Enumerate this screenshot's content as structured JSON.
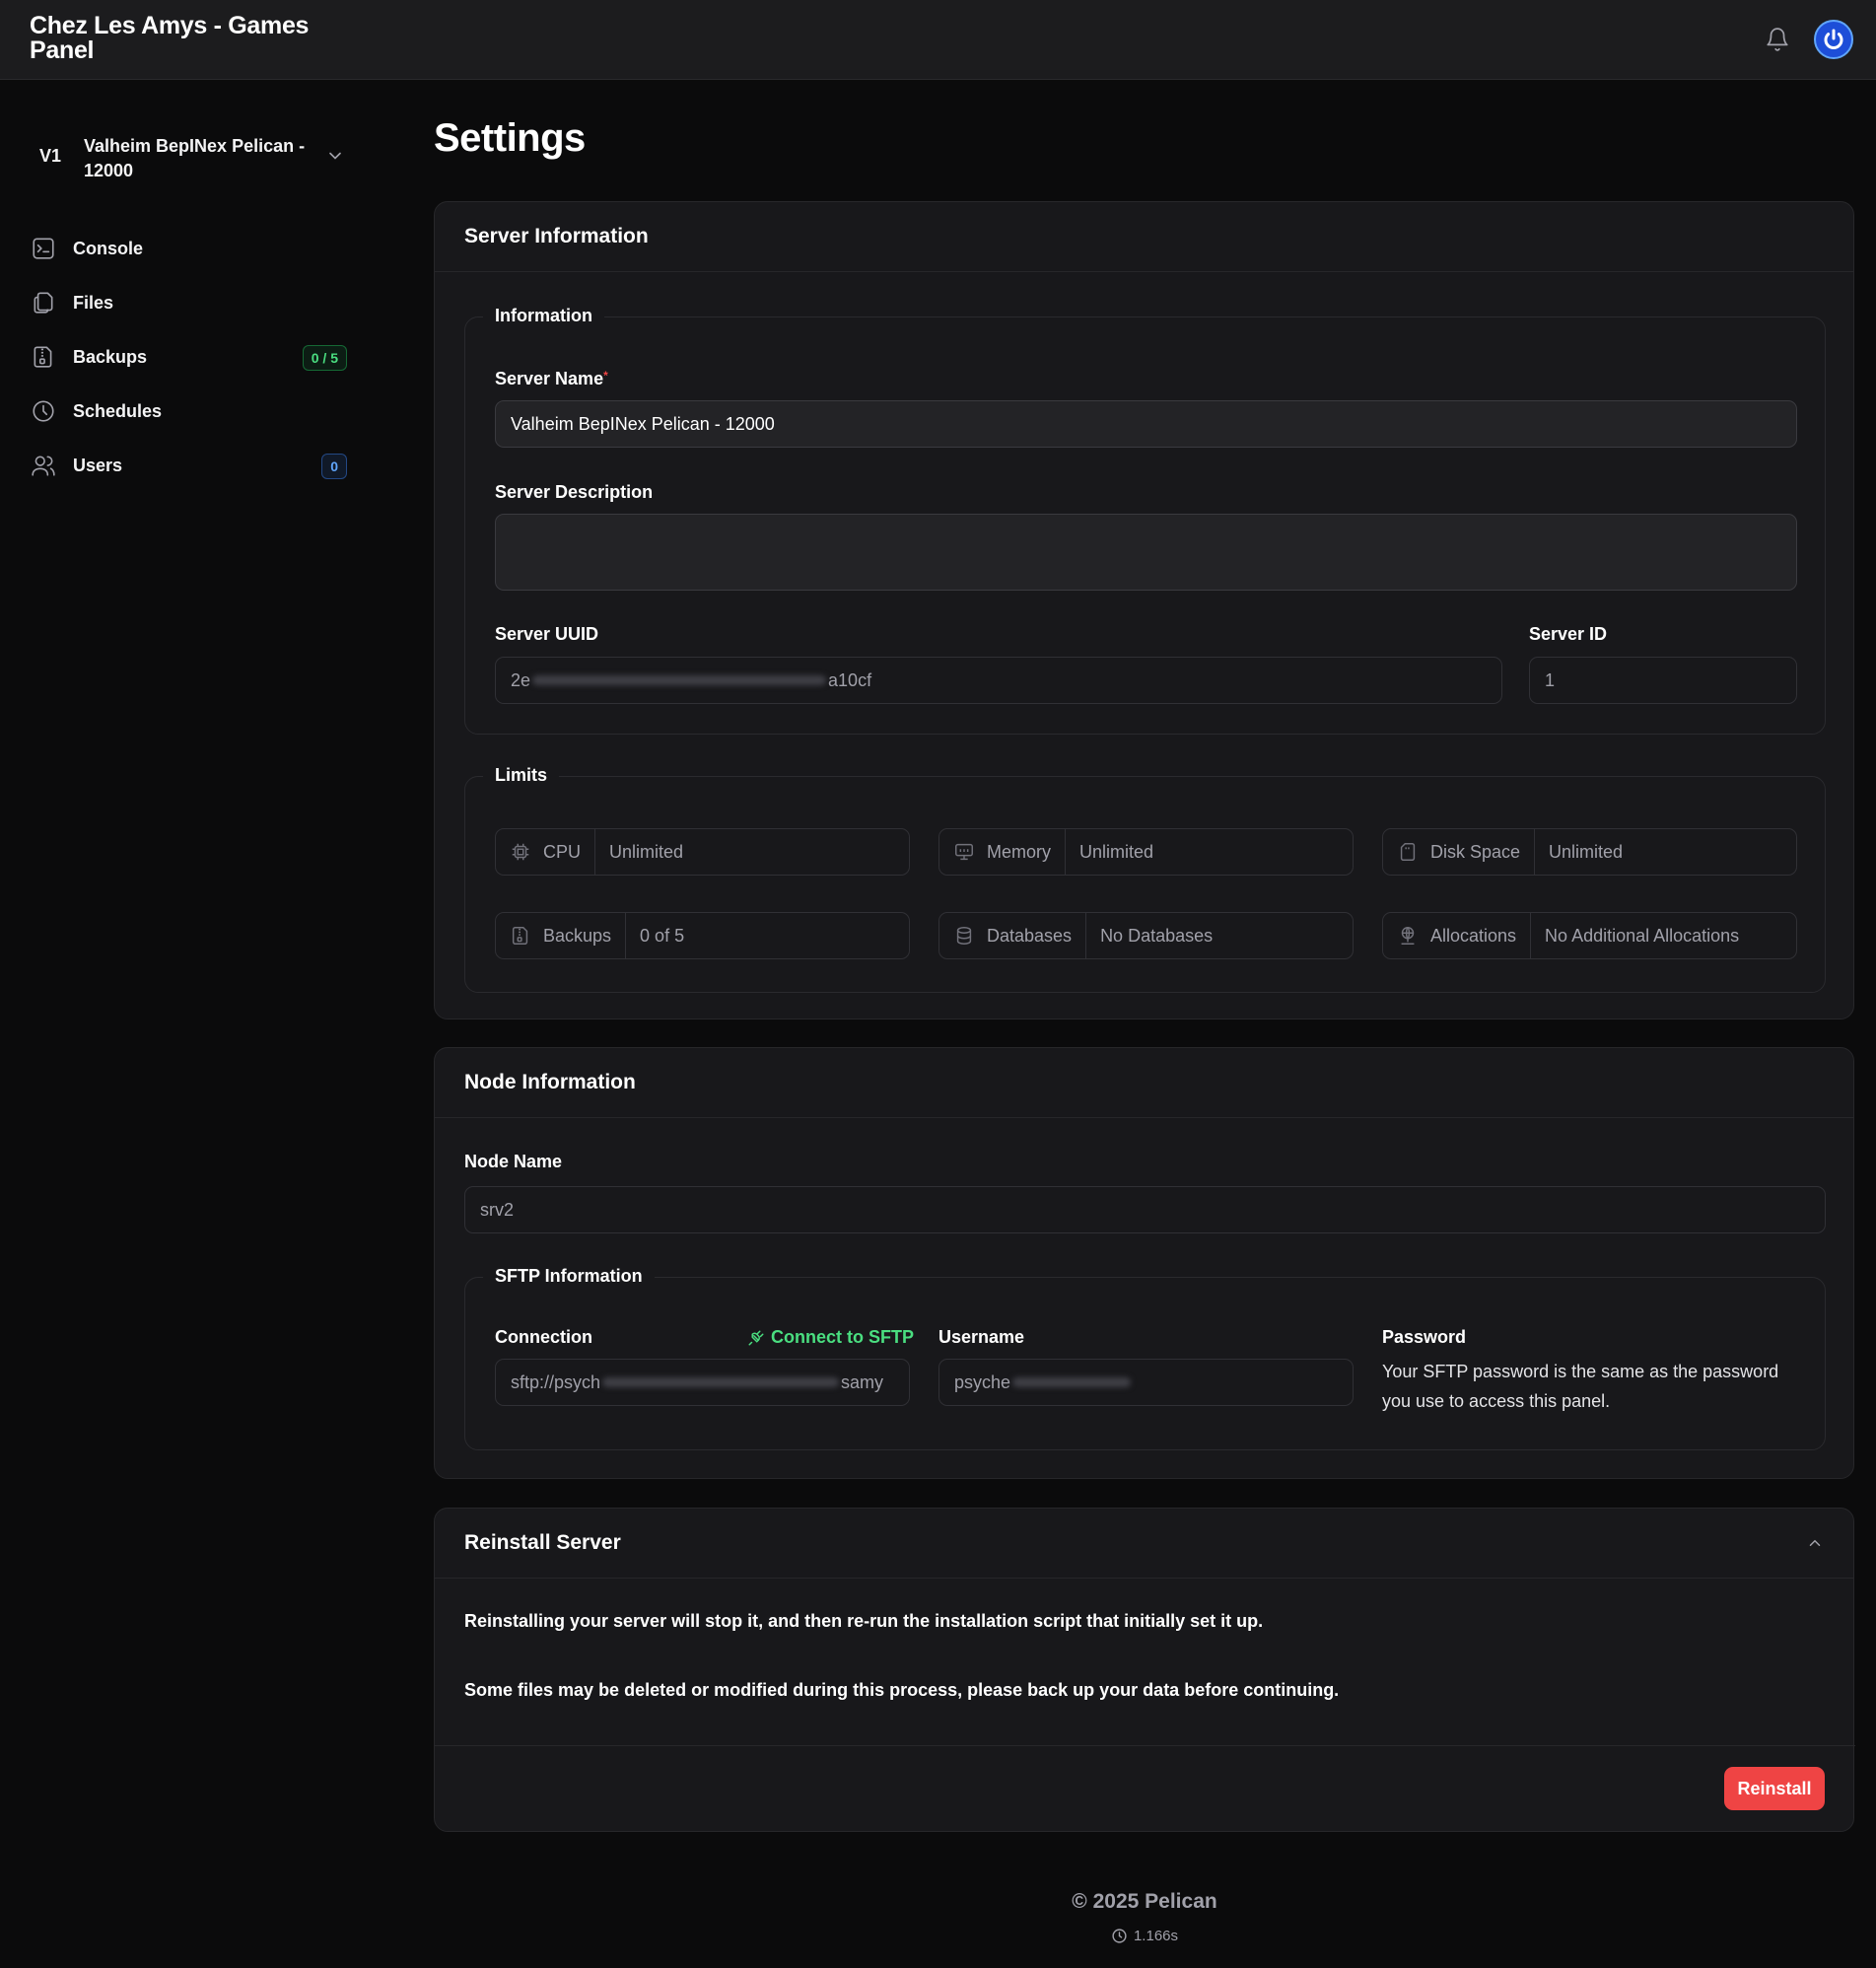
{
  "app": {
    "title": "Chez Les Amys - Games Panel"
  },
  "server_switch": {
    "short": "V1",
    "name": "Valheim BepINex Pelican - 12000"
  },
  "sidebar": {
    "items": [
      {
        "label": "Console",
        "icon": "terminal-icon"
      },
      {
        "label": "Files",
        "icon": "files-icon"
      },
      {
        "label": "Backups",
        "icon": "backup-archive-icon",
        "badge": "0 / 5"
      },
      {
        "label": "Schedules",
        "icon": "clock-icon"
      },
      {
        "label": "Users",
        "icon": "users-icon",
        "badge": "0"
      }
    ]
  },
  "page": {
    "title": "Settings"
  },
  "server_info": {
    "title": "Server Information",
    "information_legend": "Information",
    "server_name_label": "Server Name",
    "server_name_value": "Valheim BepINex Pelican - 12000",
    "server_description_label": "Server Description",
    "server_description_value": "",
    "uuid_label": "Server UUID",
    "uuid_prefix": "2e",
    "uuid_suffix": "a10cf",
    "id_label": "Server ID",
    "id_value": "1",
    "limits_legend": "Limits",
    "limits": [
      {
        "key": "CPU",
        "value": "Unlimited",
        "icon": "cpu-icon"
      },
      {
        "key": "Memory",
        "value": "Unlimited",
        "icon": "memory-icon"
      },
      {
        "key": "Disk Space",
        "value": "Unlimited",
        "icon": "disk-icon"
      },
      {
        "key": "Backups",
        "value": "0 of 5",
        "icon": "backup-archive-icon"
      },
      {
        "key": "Databases",
        "value": "No Databases",
        "icon": "database-icon"
      },
      {
        "key": "Allocations",
        "value": "No Additional Allocations",
        "icon": "network-icon"
      }
    ]
  },
  "node_info": {
    "title": "Node Information",
    "node_name_label": "Node Name",
    "node_name_value": "srv2",
    "sftp_legend": "SFTP Information",
    "connection_label": "Connection",
    "connect_link": "Connect to SFTP",
    "connection_prefix": "sftp://psych",
    "connection_suffix": "samy",
    "username_label": "Username",
    "username_prefix": "psyche",
    "password_label": "Password",
    "password_text": "Your SFTP password is the same as the password you use to access this panel."
  },
  "reinstall": {
    "title": "Reinstall Server",
    "paragraph_1": "Reinstalling your server will stop it, and then re-run the installation script that initially set it up.",
    "paragraph_2": "Some files may be deleted or modified during this process, please back up your data before continuing.",
    "button": "Reinstall"
  },
  "footer": {
    "copyright": "© 2025 Pelican",
    "time": "1.166s"
  },
  "colors": {
    "accent_green": "#4ade80",
    "danger": "#ef4444",
    "brand_blue": "#1d4ed8"
  }
}
